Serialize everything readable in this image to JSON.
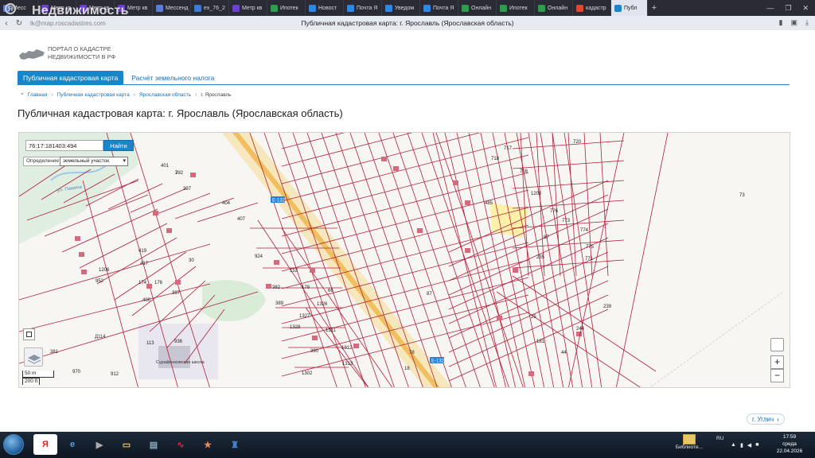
{
  "browser": {
    "tabs": [
      {
        "label": "Месс",
        "color": "#5a7dd8"
      },
      {
        "label": "Метр кв",
        "color": "#6b3fd0"
      },
      {
        "label": "Метр кв",
        "color": "#6b3fd0"
      },
      {
        "label": "Метр кв",
        "color": "#6b3fd0"
      },
      {
        "label": "Мессенд",
        "color": "#5a7dd8"
      },
      {
        "label": "ex_76_2",
        "color": "#3d7cd6"
      },
      {
        "label": "Метр кв",
        "color": "#6b3fd0"
      },
      {
        "label": "Ипотек",
        "color": "#2e9e4e"
      },
      {
        "label": "Новост",
        "color": "#2f87e8"
      },
      {
        "label": "Почта Я",
        "color": "#2f87e8"
      },
      {
        "label": "Уведом",
        "color": "#2f87e8"
      },
      {
        "label": "Почта Я",
        "color": "#2f87e8"
      },
      {
        "label": "Онлайн",
        "color": "#2e9e4e"
      },
      {
        "label": "Ипотек",
        "color": "#2e9e4e"
      },
      {
        "label": "Онлайн",
        "color": "#2e9e4e"
      },
      {
        "label": "кадастр",
        "color": "#e0492f"
      },
      {
        "label": "Публ",
        "color": "#1a86c7",
        "active": true
      }
    ],
    "new_tab": "+",
    "url_host": "lk@map.roscadastres.com",
    "window_title": "Публичная кадастровая карта: г. Ярославль (Ярославская область)",
    "brand": "Недвижимость",
    "brand_logo": "Я"
  },
  "site": {
    "logo_line1": "ПОРТАЛ О КАДАСТРЕ",
    "logo_line2": "НЕДВИЖИМОСТИ В РФ",
    "menu_active": "Публичная кадастровая карта",
    "menu_link": "Расчёт земельного налога",
    "breadcrumbs": [
      "Главная",
      "Публичная кадастровая карта",
      "Ярославская область",
      "г. Ярославль"
    ],
    "heading": "Публичная кадастровая карта: г. Ярославль (Ярославская область)",
    "next_link": "г. Углич"
  },
  "map": {
    "search_value": "76:17:181403:494",
    "search_button": "Найти",
    "define_label": "Определение",
    "define_value": "земельный участок",
    "scale_metric": "50 m",
    "scale_imperial": "200 ft",
    "zoom_in": "+",
    "zoom_out": "−",
    "road_badge": "Е-132",
    "road_badge2": "Е-132",
    "labels": [
      "392",
      "397",
      "401",
      "404",
      "407",
      "419",
      "417",
      "1206",
      "952",
      "174",
      "176",
      "400",
      "397",
      "30",
      "924",
      "153",
      "179",
      "382",
      "389",
      "1326",
      "1327",
      "1328",
      "1311",
      "1312",
      "1313",
      "390",
      "1302",
      "912",
      "970",
      "381",
      "113",
      "936",
      "720",
      "717",
      "718",
      "716",
      "1200",
      "776",
      "773",
      "774",
      "775",
      "771",
      "73",
      "485",
      "239",
      "181",
      "44",
      "25",
      "66",
      "87",
      "78",
      "18",
      "87",
      "235",
      "244",
      "7"
    ],
    "street_1": "ул. Пажина",
    "place_1": "Д114",
    "place_2": "Сурафонковская школа"
  },
  "taskbar": {
    "lang": "RU",
    "time": "17:59",
    "day": "среда",
    "date": "22.04.2026",
    "library_label": "Библиоте..."
  },
  "colors": {
    "accent": "#1a86c7",
    "parcel": "#b01f3a",
    "road": "#f0c060",
    "highlight": "#fff2a8"
  }
}
